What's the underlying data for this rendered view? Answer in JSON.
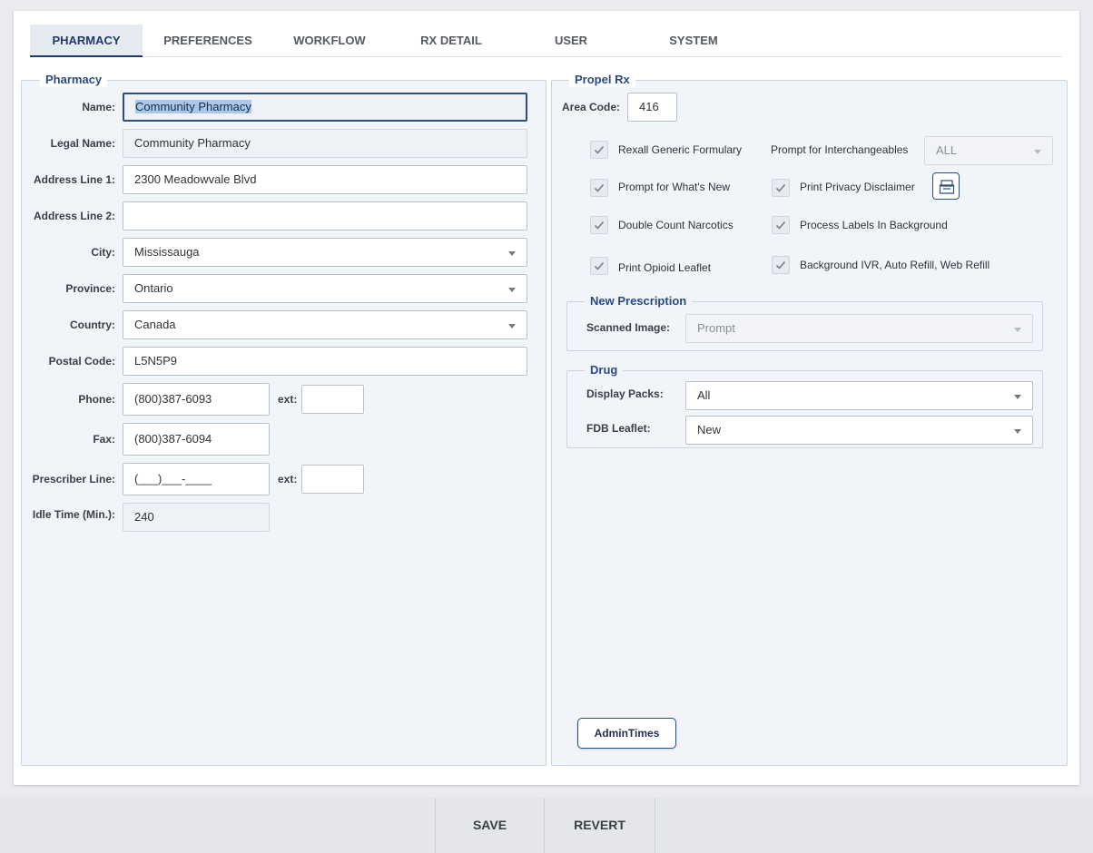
{
  "tabs": [
    "PHARMACY",
    "PREFERENCES",
    "WORKFLOW",
    "RX DETAIL",
    "USER",
    "SYSTEM"
  ],
  "pharmacy": {
    "legend": "Pharmacy",
    "name_label": "Name:",
    "name": "Community Pharmacy",
    "legal_label": "Legal Name:",
    "legal": "Community Pharmacy",
    "addr1_label": "Address Line 1:",
    "addr1": "2300 Meadowvale Blvd",
    "addr2_label": "Address Line 2:",
    "addr2": "",
    "city_label": "City:",
    "city": "Mississauga",
    "province_label": "Province:",
    "province": "Ontario",
    "country_label": "Country:",
    "country": "Canada",
    "postal_label": "Postal Code:",
    "postal": "L5N5P9",
    "phone_label": "Phone:",
    "phone": "(800)387-6093",
    "ext_label": "ext:",
    "fax_label": "Fax:",
    "fax": "(800)387-6094",
    "prescriber_label": "Prescriber Line:",
    "prescriber": "(___)___-____",
    "idle_label": "Idle Time (Min.):",
    "idle": "240"
  },
  "propel": {
    "legend": "Propel Rx",
    "area_code_label": "Area Code:",
    "area_code": "416",
    "checks": {
      "rexall": "Rexall Generic Formulary",
      "whats_new": "Prompt for What's New",
      "double_count": "Double Count Narcotics",
      "opioid": "Print Opioid Leaflet",
      "privacy": "Print Privacy Disclaimer",
      "labels_bg": "Process Labels In Background",
      "ivr": "Background IVR, Auto Refill, Web Refill"
    },
    "interchange_label": "Prompt for Interchangeables",
    "interchange": "ALL",
    "new_rx": {
      "legend": "New Prescription",
      "scanned_label": "Scanned Image:",
      "scanned": "Prompt"
    },
    "drug": {
      "legend": "Drug",
      "packs_label": "Display Packs:",
      "packs": "All",
      "leaflet_label": "FDB Leaflet:",
      "leaflet": "New"
    },
    "admin_button": "AdminTimes"
  },
  "footer": {
    "save": "SAVE",
    "revert": "REVERT"
  }
}
